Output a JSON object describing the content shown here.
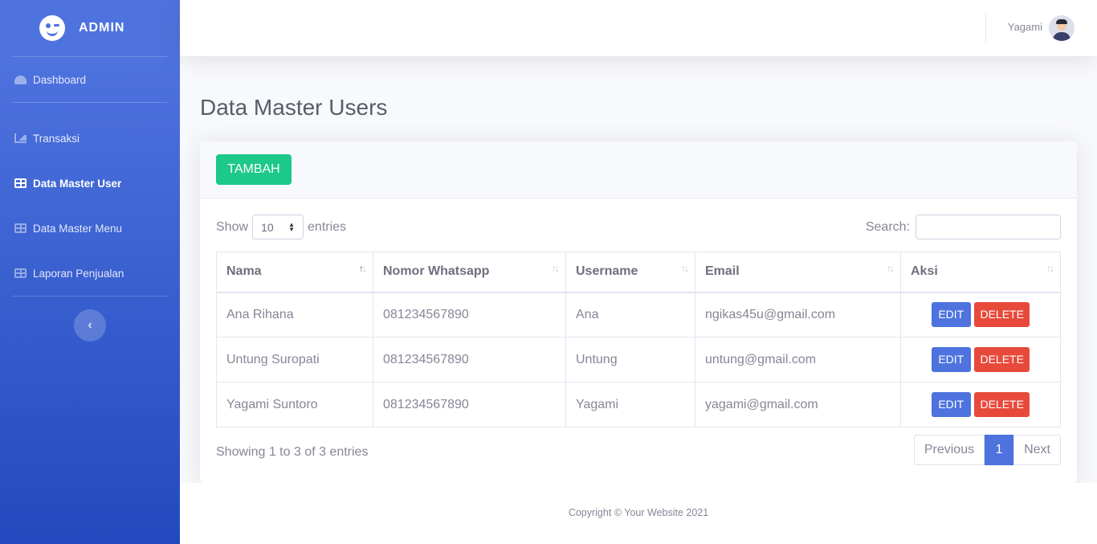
{
  "brand": {
    "text": "ADMIN",
    "icon": "laugh-wink-icon"
  },
  "sidebar": {
    "items": [
      {
        "label": "Dashboard",
        "icon": "tachometer-icon"
      },
      {
        "label": "Transaksi",
        "icon": "area-chart-icon"
      },
      {
        "label": "Data Master User",
        "icon": "table-icon",
        "active": true
      },
      {
        "label": "Data Master Menu",
        "icon": "table-icon"
      },
      {
        "label": "Laporan Penjualan",
        "icon": "table-icon"
      }
    ],
    "toggle_icon": "chevron-left-icon"
  },
  "topbar": {
    "user_name": "Yagami"
  },
  "page": {
    "title": "Data Master Users"
  },
  "card": {
    "add_button": "TAMBAH",
    "show_label": "Show",
    "entries_label": "entries",
    "page_length": "10",
    "search_label": "Search:",
    "search_value": ""
  },
  "table": {
    "columns": [
      "Nama",
      "Nomor Whatsapp",
      "Username",
      "Email",
      "Aksi"
    ],
    "rows": [
      {
        "nama": "Ana Rihana",
        "whatsapp": "081234567890",
        "username": "Ana",
        "email": "ngikas45u@gmail.com"
      },
      {
        "nama": "Untung Suropati",
        "whatsapp": "081234567890",
        "username": "Untung",
        "email": "untung@gmail.com"
      },
      {
        "nama": "Yagami Suntoro",
        "whatsapp": "081234567890",
        "username": "Yagami",
        "email": "yagami@gmail.com"
      }
    ],
    "edit_label": "EDIT",
    "delete_label": "DELETE"
  },
  "footer_info": "Showing 1 to 3 of 3 entries",
  "pagination": {
    "previous": "Previous",
    "current": "1",
    "next": "Next"
  },
  "footer": {
    "copyright": "Copyright © Your Website 2021"
  },
  "colors": {
    "primary": "#4e73df",
    "success": "#1cc88a",
    "danger": "#e74a3b"
  }
}
